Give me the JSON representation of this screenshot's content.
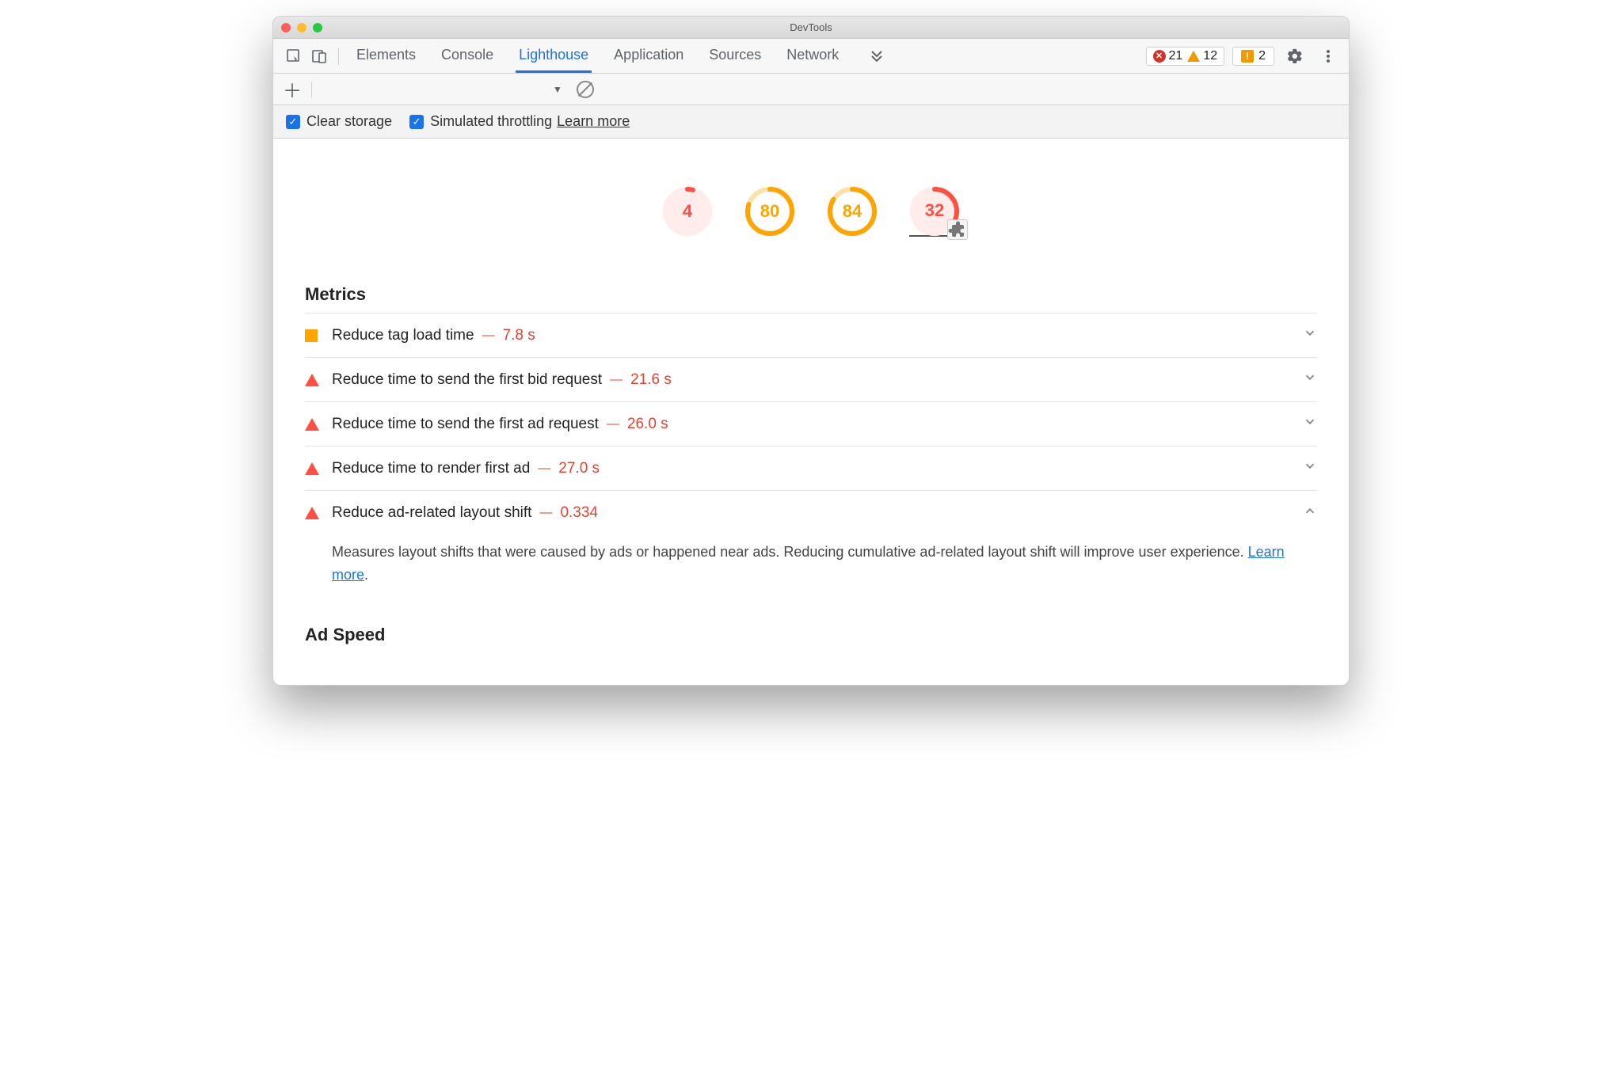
{
  "window": {
    "title": "DevTools"
  },
  "tabs": {
    "items": [
      "Elements",
      "Console",
      "Lighthouse",
      "Application",
      "Sources",
      "Network"
    ],
    "active_index": 2
  },
  "status": {
    "errors": "21",
    "warnings": "12",
    "issues": "2"
  },
  "options": {
    "clear_storage": "Clear storage",
    "simulated_throttling": "Simulated throttling",
    "learn_more": "Learn more"
  },
  "gauges": [
    {
      "value": 4,
      "color": "red",
      "pct": 4
    },
    {
      "value": 80,
      "color": "orange",
      "pct": 80
    },
    {
      "value": 84,
      "color": "orange",
      "pct": 84
    },
    {
      "value": 32,
      "color": "red2",
      "pct": 32,
      "has_ext": true,
      "selected": true
    }
  ],
  "sections": {
    "metrics_title": "Metrics",
    "adspeed_title": "Ad Speed"
  },
  "metrics": [
    {
      "icon": "square",
      "title": "Reduce tag load time",
      "value": "7.8 s",
      "expanded": false
    },
    {
      "icon": "triangle",
      "title": "Reduce time to send the first bid request",
      "value": "21.6 s",
      "expanded": false
    },
    {
      "icon": "triangle",
      "title": "Reduce time to send the first ad request",
      "value": "26.0 s",
      "expanded": false
    },
    {
      "icon": "triangle",
      "title": "Reduce time to render first ad",
      "value": "27.0 s",
      "expanded": false
    },
    {
      "icon": "triangle",
      "title": "Reduce ad-related layout shift",
      "value": "0.334",
      "expanded": true,
      "desc": "Measures layout shifts that were caused by ads or happened near ads. Reducing cumulative ad-related layout shift will improve user experience. ",
      "desc_link": "Learn more"
    }
  ]
}
